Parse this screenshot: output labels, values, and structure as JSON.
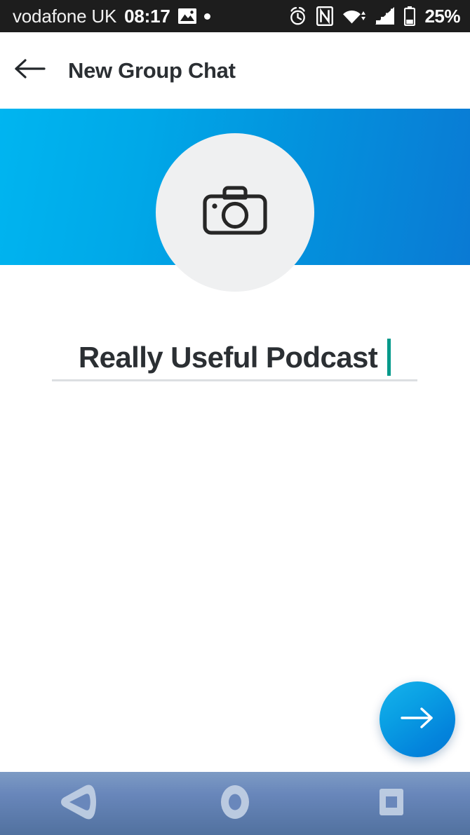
{
  "status_bar": {
    "carrier": "vodafone UK",
    "time": "08:17",
    "battery_percent": "25%",
    "icons": {
      "photo": "photo-icon",
      "dot": "dot-icon",
      "alarm": "alarm-clock-icon",
      "nfc": "nfc-icon",
      "wifi": "wifi-icon",
      "signal": "cellular-signal-icon",
      "battery": "battery-icon"
    },
    "background": "#1d1d1d"
  },
  "app_bar": {
    "title": "New Group Chat",
    "back_icon": "arrow-left-icon",
    "background": "#ffffff",
    "title_color": "#2b2f33"
  },
  "banner": {
    "gradient_start": "#00b5f0",
    "gradient_end": "#0a7ad4"
  },
  "avatar": {
    "icon": "camera-icon",
    "background": "#eff0f1",
    "icon_color": "#262626"
  },
  "group_name_field": {
    "value": "Really Useful Podcast",
    "placeholder": "Group name",
    "cursor_color": "#00998a",
    "underline_color": "#dcdfe2",
    "text_color": "#2b2f33"
  },
  "fab": {
    "icon": "arrow-right-icon",
    "label": "Next",
    "gradient_start": "#17b3ec",
    "gradient_end": "#0379d3"
  },
  "nav_bar": {
    "buttons": [
      {
        "name": "back",
        "icon": "nav-back-triangle-icon"
      },
      {
        "name": "home",
        "icon": "nav-home-circle-icon"
      },
      {
        "name": "recents",
        "icon": "nav-recents-square-icon"
      }
    ],
    "gradient_start": "#7d9bc4",
    "gradient_end": "#51719f"
  }
}
